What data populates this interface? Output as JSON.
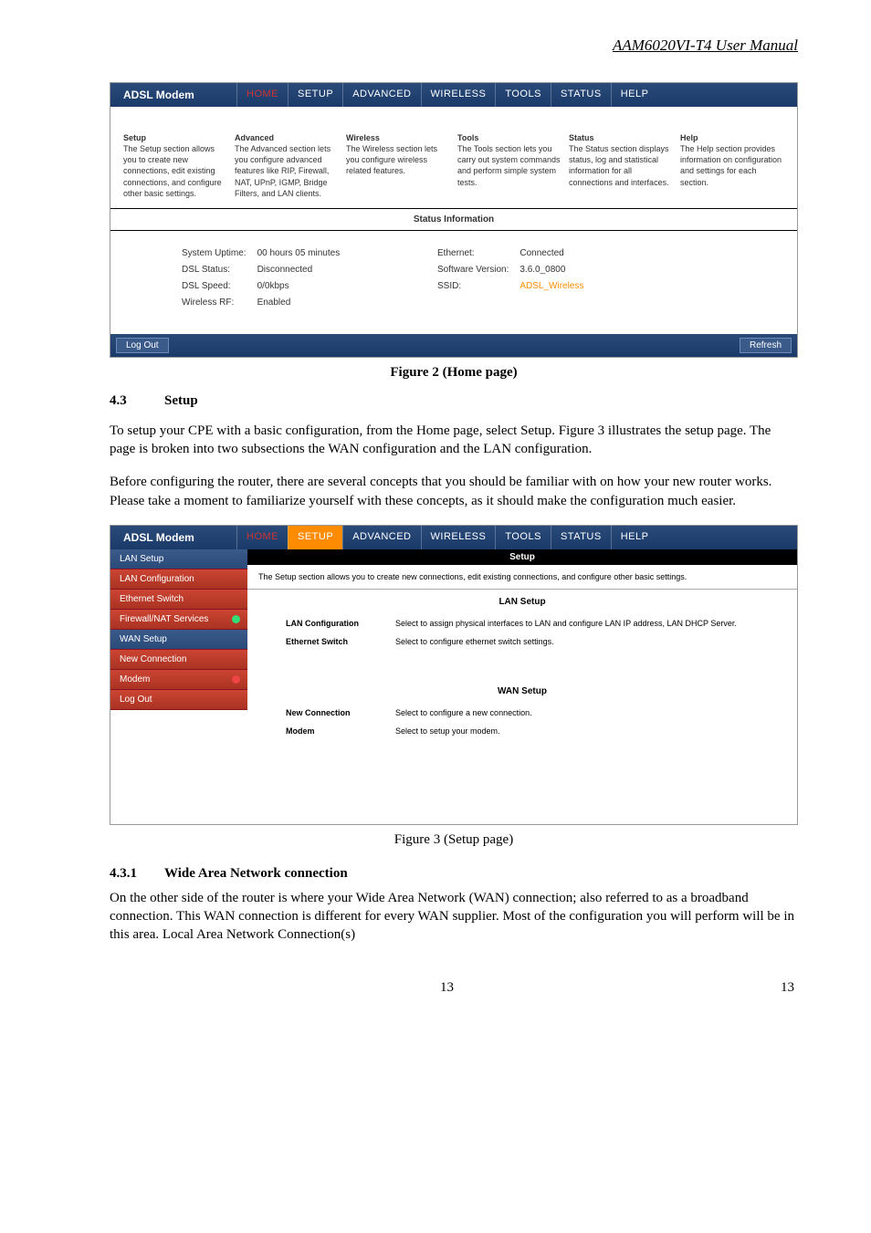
{
  "header": "AAM6020VI-T4 User Manual",
  "fig1": {
    "brand": "ADSL Modem",
    "tabs": [
      "HOME",
      "SETUP",
      "ADVANCED",
      "WIRELESS",
      "TOOLS",
      "STATUS",
      "HELP"
    ],
    "modules": [
      {
        "t": "Setup",
        "d": "The Setup section allows you to create new connections, edit existing connections, and configure other basic settings."
      },
      {
        "t": "Advanced",
        "d": "The Advanced section lets you configure advanced features like RIP, Firewall, NAT, UPnP, IGMP, Bridge Filters, and LAN clients."
      },
      {
        "t": "Wireless",
        "d": "The Wireless section lets you configure wireless related features."
      },
      {
        "t": "Tools",
        "d": "The Tools section lets you carry out system commands and perform simple system tests."
      },
      {
        "t": "Status",
        "d": "The Status section displays status, log and statistical information for all connections and interfaces."
      },
      {
        "t": "Help",
        "d": "The Help section provides information on configuration and settings for each section."
      }
    ],
    "statusTitle": "Status Information",
    "left": [
      [
        "System Uptime:",
        "00 hours 05 minutes"
      ],
      [
        "DSL Status:",
        "Disconnected"
      ],
      [
        "DSL Speed:",
        "0/0kbps"
      ],
      [
        "Wireless RF:",
        "Enabled"
      ]
    ],
    "right": [
      [
        "Ethernet:",
        "Connected"
      ],
      [
        "Software Version:",
        "3.6.0_0800"
      ],
      [
        "SSID:",
        "ADSL_Wireless"
      ]
    ],
    "logout": "Log Out",
    "refresh": "Refresh"
  },
  "cap1": "Figure 2 (Home page)",
  "sec43_num": "4.3",
  "sec43_title": "Setup",
  "para1": "To setup your CPE with a basic configuration, from the Home page, select Setup.  Figure 3 illustrates the setup page.  The page is broken into two subsections the WAN configuration and the LAN configuration.",
  "para2": "Before configuring the router, there are several concepts that you should be familiar with on how your new router works. Please take a moment to familiarize yourself with these concepts, as it should make the configuration much easier.",
  "fig2": {
    "brand": "ADSL Modem",
    "tabs": [
      "HOME",
      "SETUP",
      "ADVANCED",
      "WIRELESS",
      "TOOLS",
      "STATUS",
      "HELP"
    ],
    "side": [
      {
        "l": "LAN Setup",
        "c": "blue"
      },
      {
        "l": "LAN Configuration",
        "c": "red"
      },
      {
        "l": "Ethernet Switch",
        "c": "red"
      },
      {
        "l": "Firewall/NAT Services",
        "c": "red",
        "dot": "green"
      },
      {
        "l": "WAN Setup",
        "c": "blue"
      },
      {
        "l": "New Connection",
        "c": "red"
      },
      {
        "l": "Modem",
        "c": "red",
        "dot": "red"
      },
      {
        "l": "Log Out",
        "c": "red"
      }
    ],
    "panelTitle": "Setup",
    "panelDesc": "The Setup section allows you to create new connections, edit existing connections, and configure other basic settings.",
    "lanTitle": "LAN Setup",
    "lanRows": [
      [
        "LAN Configuration",
        "Select to assign physical interfaces to LAN and configure LAN IP address, LAN DHCP Server."
      ],
      [
        "Ethernet Switch",
        "Select to configure ethernet switch settings."
      ]
    ],
    "wanTitle": "WAN Setup",
    "wanRows": [
      [
        "New Connection",
        "Select to configure a new connection."
      ],
      [
        "Modem",
        "Select to setup your modem."
      ]
    ]
  },
  "cap2": "Figure 3 (Setup page)",
  "sec431_num": "4.3.1",
  "sec431_title": "Wide Area Network connection",
  "para3": "On the other side of the router is where your Wide Area Network (WAN) connection; also referred to as a broadband connection. This WAN connection is different for every WAN supplier. Most of the configuration you will perform will be in this area. Local Area Network Connection(s)",
  "pnum": "13"
}
